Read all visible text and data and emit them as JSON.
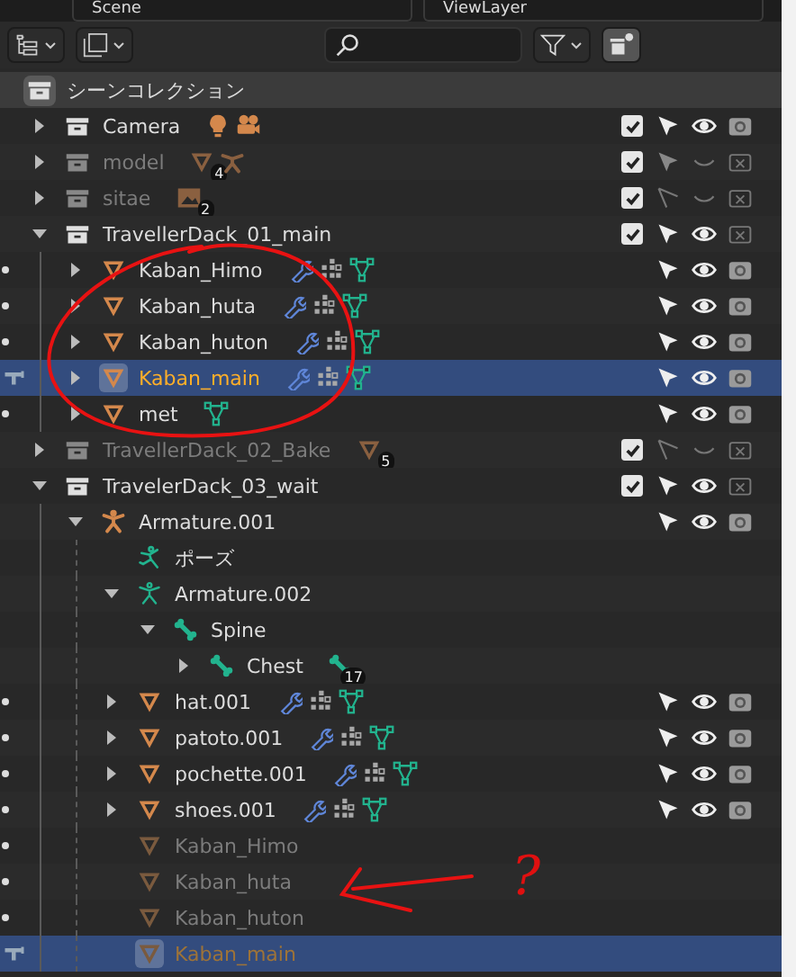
{
  "header": {
    "scene": "Scene",
    "view_layer": "ViewLayer"
  },
  "scene_collection": {
    "name": "シーンコレクション"
  },
  "rows": [
    {
      "kind": "collection",
      "name": "Camera",
      "expanded": false,
      "dimmed": false,
      "checked": true,
      "select": true,
      "visible": true,
      "render": true,
      "badges": [
        {
          "kind": "light"
        },
        {
          "kind": "camera"
        }
      ]
    },
    {
      "kind": "collection",
      "name": "model",
      "expanded": false,
      "dimmed": true,
      "checked": true,
      "select": true,
      "visible": false,
      "render": false,
      "badges": [
        {
          "kind": "mesh",
          "count": "4"
        },
        {
          "kind": "armature"
        }
      ]
    },
    {
      "kind": "collection",
      "name": "sitae",
      "expanded": false,
      "dimmed": true,
      "checked": true,
      "select": false,
      "visible": false,
      "render": false,
      "badges": [
        {
          "kind": "image",
          "count": "2"
        }
      ]
    },
    {
      "kind": "collection",
      "name": "TravellerDack_01_main",
      "expanded": true,
      "dimmed": false,
      "checked": true,
      "select": true,
      "visible": true,
      "render": false,
      "children": [
        {
          "kind": "mesh",
          "name": "Kaban_Himo",
          "expanded": false,
          "dimmed": false,
          "selected": false,
          "active": false,
          "edit_mode": false,
          "select": true,
          "visible": true,
          "render": true,
          "badges": [
            {
              "kind": "modifier"
            },
            {
              "kind": "vertex_groups"
            },
            {
              "kind": "mesh_data"
            }
          ]
        },
        {
          "kind": "mesh",
          "name": "Kaban_huta",
          "expanded": false,
          "dimmed": false,
          "selected": false,
          "active": false,
          "edit_mode": false,
          "select": true,
          "visible": true,
          "render": true,
          "badges": [
            {
              "kind": "modifier"
            },
            {
              "kind": "vertex_groups"
            },
            {
              "kind": "mesh_data"
            }
          ]
        },
        {
          "kind": "mesh",
          "name": "Kaban_huton",
          "expanded": false,
          "dimmed": false,
          "selected": false,
          "active": false,
          "edit_mode": false,
          "select": true,
          "visible": true,
          "render": true,
          "badges": [
            {
              "kind": "modifier"
            },
            {
              "kind": "vertex_groups"
            },
            {
              "kind": "mesh_data"
            }
          ]
        },
        {
          "kind": "mesh",
          "name": "Kaban_main",
          "expanded": false,
          "dimmed": false,
          "selected": true,
          "active": true,
          "edit_mode": true,
          "select": true,
          "visible": true,
          "render": true,
          "badges": [
            {
              "kind": "modifier"
            },
            {
              "kind": "vertex_groups"
            },
            {
              "kind": "mesh_data"
            }
          ]
        },
        {
          "kind": "mesh",
          "name": "met",
          "expanded": false,
          "dimmed": false,
          "selected": false,
          "active": false,
          "edit_mode": false,
          "select": true,
          "visible": true,
          "render": true,
          "badges": [
            {
              "kind": "mesh_data"
            }
          ]
        }
      ]
    },
    {
      "kind": "collection",
      "name": "TravellerDack_02_Bake",
      "expanded": false,
      "dimmed": true,
      "checked": true,
      "select": false,
      "visible": false,
      "render": false,
      "badges": [
        {
          "kind": "mesh",
          "count": "5"
        }
      ]
    },
    {
      "kind": "collection",
      "name": "TravelerDack_03_wait",
      "expanded": true,
      "dimmed": false,
      "checked": true,
      "select": true,
      "visible": true,
      "render": false,
      "children": [
        {
          "kind": "armature",
          "name": "Armature.001",
          "expanded": true,
          "dimmed": false,
          "selected": false,
          "active": false,
          "select": true,
          "visible": true,
          "render": true,
          "children": [
            {
              "kind": "pose",
              "name": "ポーズ",
              "dimmed": false
            },
            {
              "kind": "armature_data",
              "name": "Armature.002",
              "expanded": true,
              "dimmed": false,
              "children": [
                {
                  "kind": "bone",
                  "name": "Spine",
                  "expanded": true,
                  "dimmed": false,
                  "children": [
                    {
                      "kind": "bone",
                      "name": "Chest",
                      "expanded": false,
                      "dimmed": false,
                      "badges": [
                        {
                          "kind": "bone",
                          "count": "17"
                        }
                      ]
                    }
                  ]
                }
              ]
            },
            {
              "kind": "mesh",
              "name": "hat.001",
              "expanded": false,
              "dimmed": false,
              "selected": false,
              "active": false,
              "edit_mode": false,
              "select": true,
              "visible": true,
              "render": true,
              "badges": [
                {
                  "kind": "modifier"
                },
                {
                  "kind": "vertex_groups"
                },
                {
                  "kind": "mesh_data"
                }
              ]
            },
            {
              "kind": "mesh",
              "name": "patoto.001",
              "expanded": false,
              "dimmed": false,
              "selected": false,
              "active": false,
              "edit_mode": false,
              "select": true,
              "visible": true,
              "render": true,
              "badges": [
                {
                  "kind": "modifier"
                },
                {
                  "kind": "vertex_groups"
                },
                {
                  "kind": "mesh_data"
                }
              ]
            },
            {
              "kind": "mesh",
              "name": "pochette.001",
              "expanded": false,
              "dimmed": false,
              "selected": false,
              "active": false,
              "edit_mode": false,
              "select": true,
              "visible": true,
              "render": true,
              "badges": [
                {
                  "kind": "modifier"
                },
                {
                  "kind": "vertex_groups"
                },
                {
                  "kind": "mesh_data"
                }
              ]
            },
            {
              "kind": "mesh",
              "name": "shoes.001",
              "expanded": false,
              "dimmed": false,
              "selected": false,
              "active": false,
              "edit_mode": false,
              "select": true,
              "visible": true,
              "render": true,
              "badges": [
                {
                  "kind": "modifier"
                },
                {
                  "kind": "vertex_groups"
                },
                {
                  "kind": "mesh_data"
                }
              ]
            },
            {
              "kind": "mesh",
              "name": "Kaban_Himo",
              "dimmed": true,
              "selected": false,
              "active": false,
              "edit_mode": false
            },
            {
              "kind": "mesh",
              "name": "Kaban_huta",
              "dimmed": true,
              "selected": false,
              "active": false,
              "edit_mode": false
            },
            {
              "kind": "mesh",
              "name": "Kaban_huton",
              "dimmed": true,
              "selected": false,
              "active": false,
              "edit_mode": false
            },
            {
              "kind": "mesh",
              "name": "Kaban_main",
              "dimmed": true,
              "selected": true,
              "active": true,
              "edit_mode": true
            }
          ]
        }
      ]
    }
  ],
  "annotation": {
    "note": "?"
  }
}
